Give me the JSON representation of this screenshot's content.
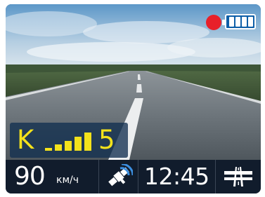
{
  "status": {
    "recording_color": "#e8202a",
    "battery_color": "#0e5fa8",
    "battery_bars_filled": 4,
    "battery_bars_total": 4
  },
  "radar": {
    "band": "K",
    "signal_level_text": "5",
    "signal_bars_filled": 5,
    "signal_bars_total": 5,
    "text_color": "#f4e21b"
  },
  "statusbar": {
    "speed_value": "90",
    "speed_unit": "км/ч",
    "gps_icon": "satellite-icon",
    "time": "12:45",
    "road_icon": "highway-icon"
  },
  "icons": [
    "record-dot-icon",
    "battery-icon",
    "signal-strength-icon",
    "satellite-icon",
    "highway-icon"
  ]
}
